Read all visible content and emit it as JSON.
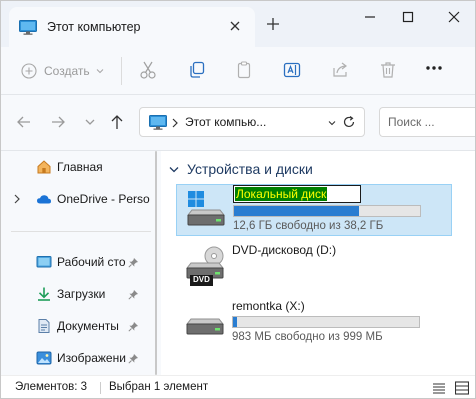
{
  "window": {
    "tab_title": "Этот компьютер",
    "icons": [
      "this-pc-icon",
      "close-icon",
      "plus-icon",
      "minimize-icon",
      "maximize-icon",
      "close-icon"
    ]
  },
  "toolbar": {
    "create_label": "Создать",
    "icons": [
      "cut-icon",
      "copy-icon",
      "paste-icon",
      "rename-icon",
      "share-icon",
      "delete-icon",
      "more-icon"
    ]
  },
  "address": {
    "path_text": "Этот компью...",
    "search_placeholder": "Поиск ..."
  },
  "sidebar": {
    "items": [
      {
        "label": "Главная",
        "icon": "home-icon"
      },
      {
        "label": "OneDrive - Perso",
        "icon": "cloud-icon"
      },
      {
        "label": "Рабочий сто",
        "icon": "desktop-icon"
      },
      {
        "label": "Загрузки",
        "icon": "download-icon"
      },
      {
        "label": "Документы",
        "icon": "documents-icon"
      },
      {
        "label": "Изображени",
        "icon": "pictures-icon"
      }
    ]
  },
  "main": {
    "group_title": "Устройства и диски",
    "drives": [
      {
        "name": "Локальный диск",
        "info": "12,6 ГБ свободно из 38,2 ГБ",
        "used_fraction": 0.67,
        "icon": "windows-drive-icon"
      },
      {
        "name": "DVD-дисковод (D:)",
        "icon": "dvd-drive-icon",
        "badge": "DVD"
      },
      {
        "name": "remontka (X:)",
        "info": "983 МБ свободно из 999 МБ",
        "used_fraction": 0.02,
        "icon": "hard-drive-icon"
      }
    ]
  },
  "status": {
    "count": "Элементов: 3",
    "selected": "Выбран 1 элемент",
    "icons": [
      "details-view-icon",
      "tiles-view-icon"
    ]
  },
  "colors": {
    "selection": "#cde6f7",
    "bar_fill": "#2a7dd1",
    "rename_highlight_bg": "#008000",
    "rename_highlight_fg": "#ffff00"
  }
}
